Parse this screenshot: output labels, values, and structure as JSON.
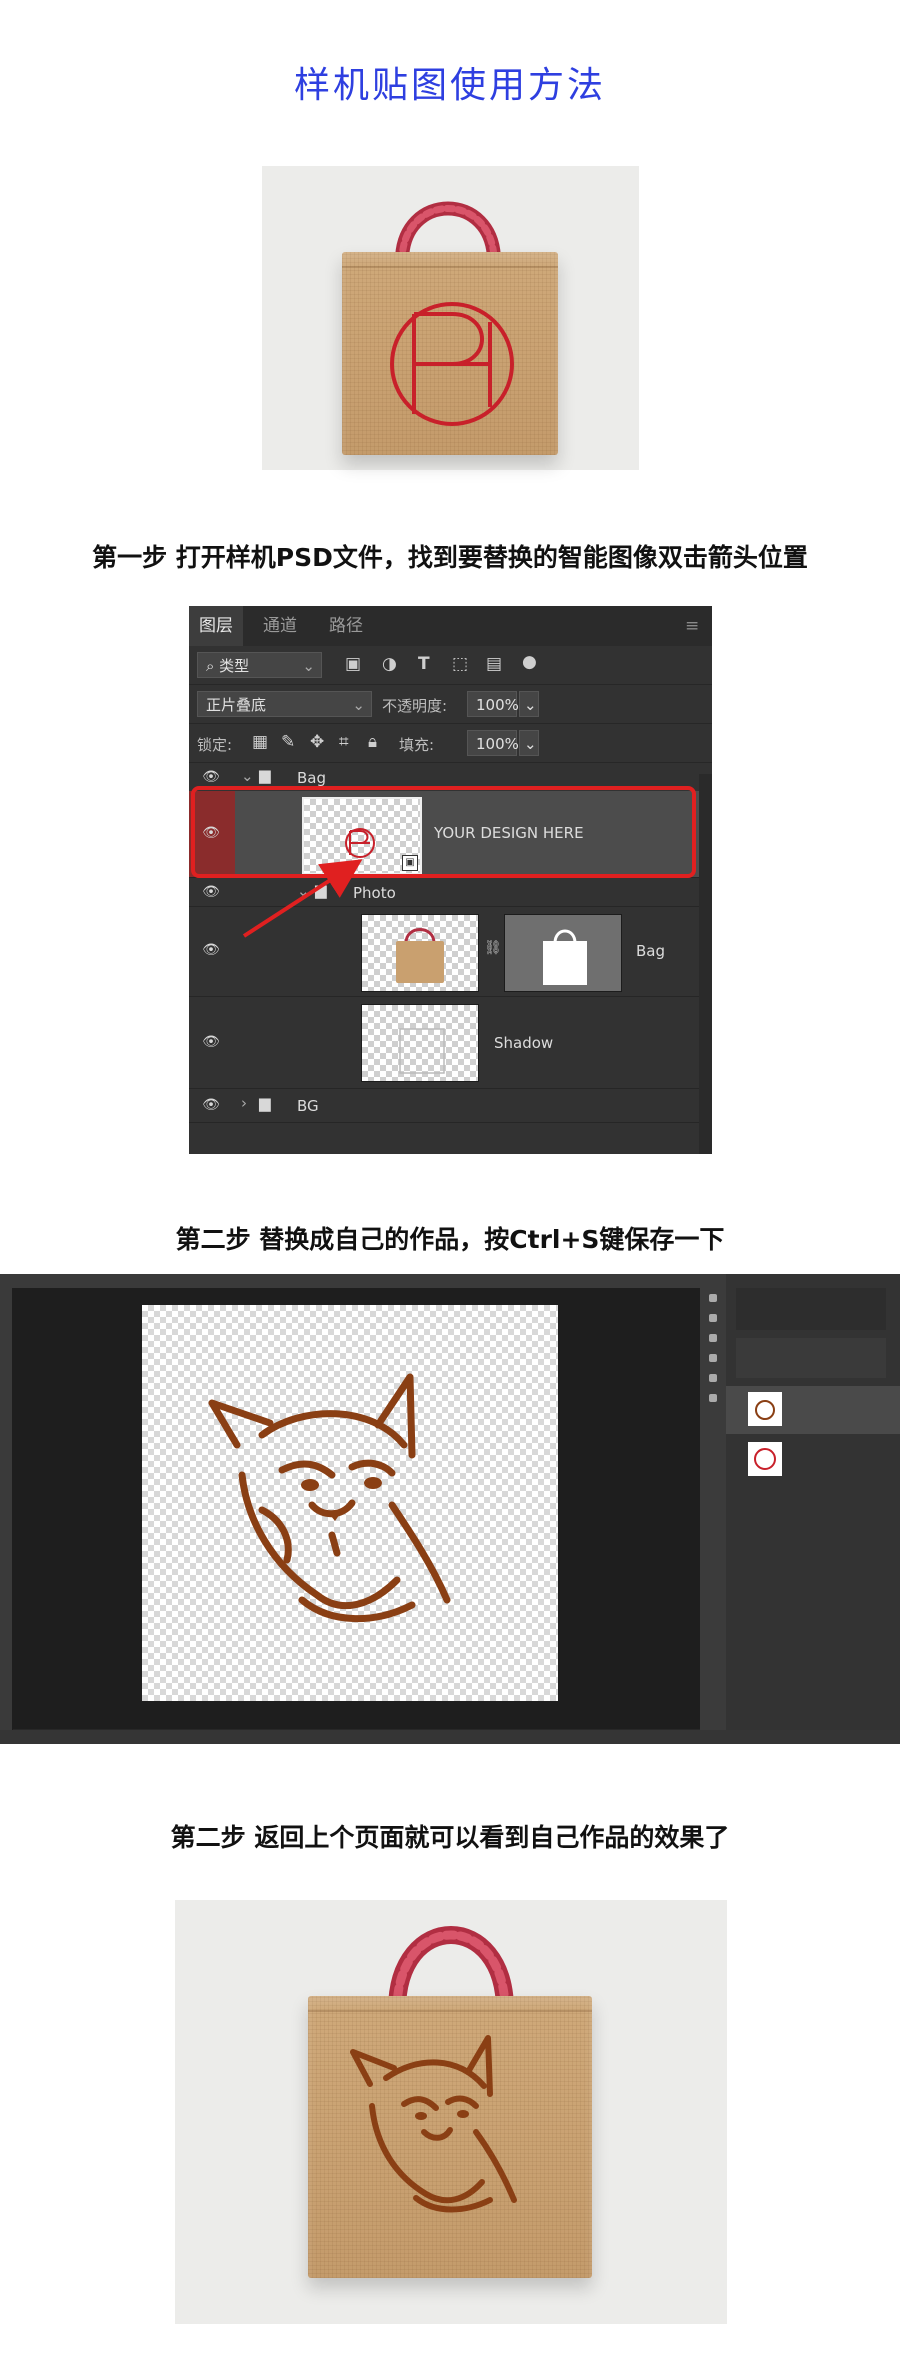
{
  "page": {
    "title": "样机贴图使用方法",
    "step1": "第一步  打开样机PSD文件，找到要替换的智能图像双击箭头位置",
    "step2": "第二步  替换成自己的作品，按Ctrl+S键保存一下",
    "step3": "第二步  返回上个页面就可以看到自己作品的效果了"
  },
  "colors": {
    "title": "#2e3fe0",
    "logo_red": "#c8202a",
    "cat_brown": "#8a3f14",
    "highlight_red": "#e02020",
    "handle_red": "#c83a4c"
  },
  "layers_panel": {
    "tabs": [
      "图层",
      "通道",
      "路径"
    ],
    "filter_kind": "类型",
    "blend_mode": "正片叠底",
    "opacity_label": "不透明度:",
    "opacity_value": "100%",
    "lock_label": "锁定:",
    "fill_label": "填充:",
    "fill_value": "100%",
    "layers": [
      {
        "name": "Bag",
        "kind": "group"
      },
      {
        "name": "YOUR DESIGN HERE",
        "kind": "smart-object",
        "selected": true
      },
      {
        "name": "Photo",
        "kind": "group"
      },
      {
        "name": "Bag",
        "kind": "masked-image"
      },
      {
        "name": "Shadow",
        "kind": "image"
      },
      {
        "name": "BG",
        "kind": "group"
      }
    ]
  }
}
